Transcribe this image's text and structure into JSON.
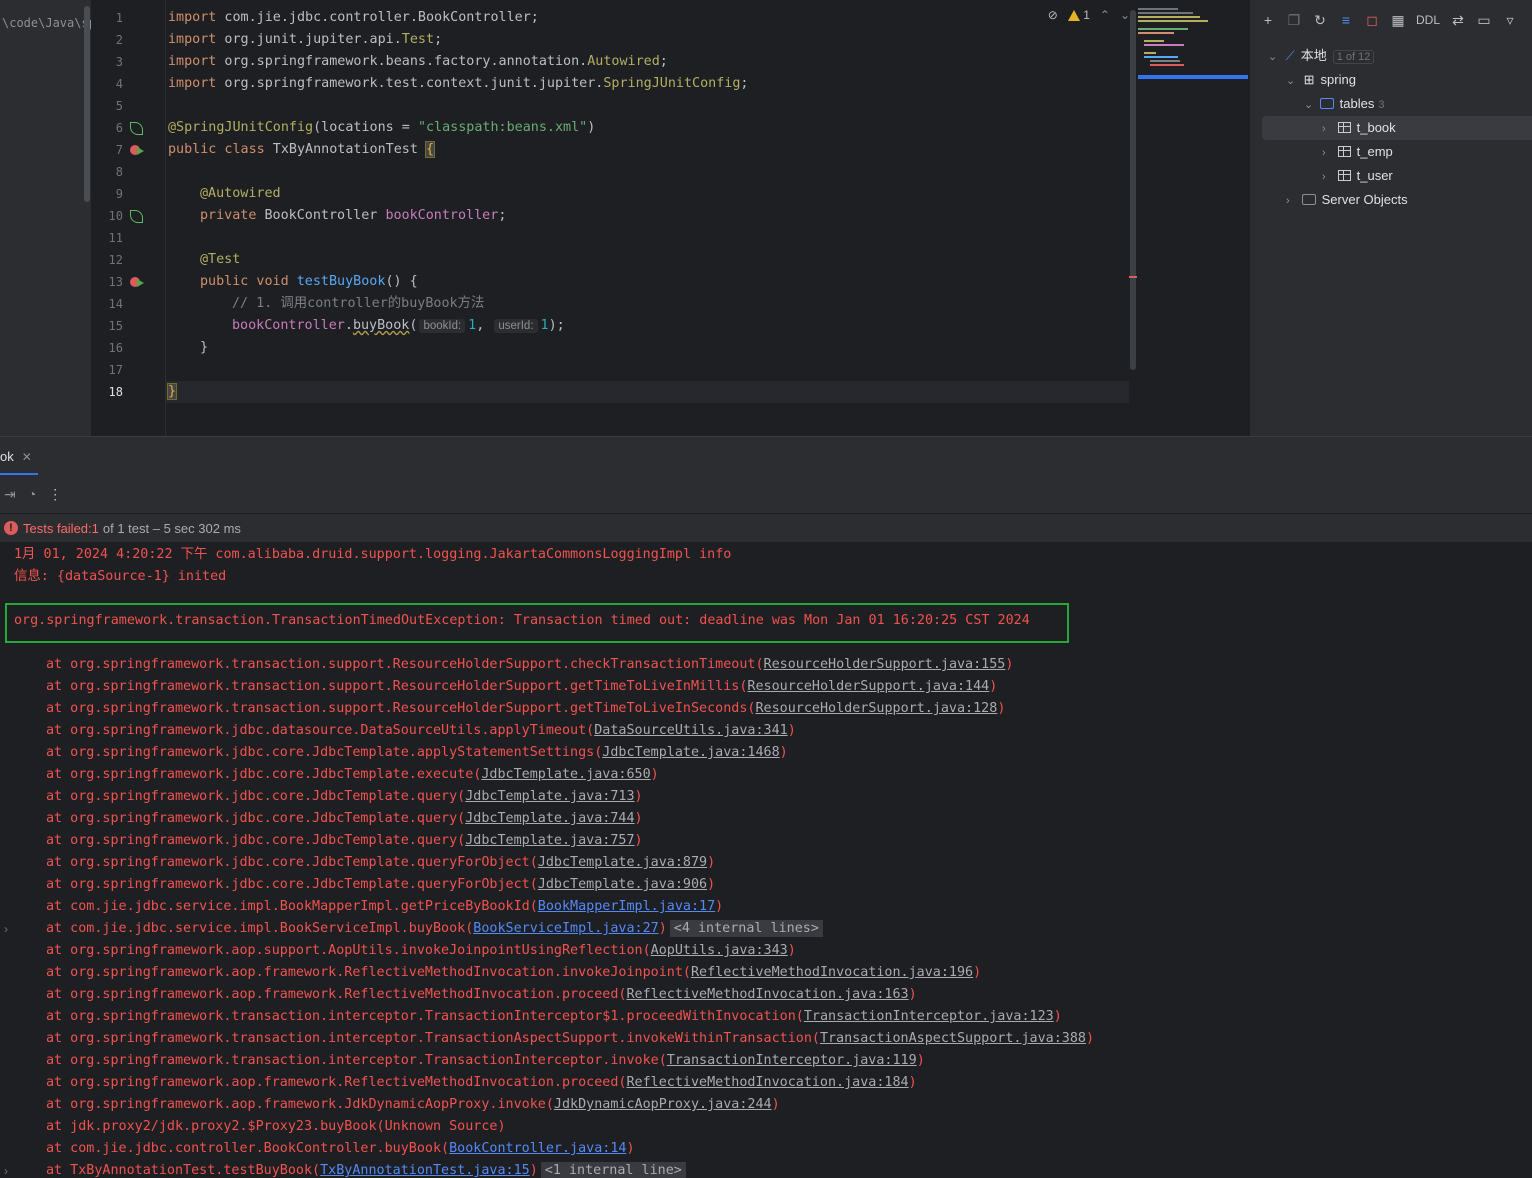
{
  "project": {
    "path": "\\code\\Java\\sp"
  },
  "editor": {
    "line_numbers": [
      "1",
      "2",
      "3",
      "4",
      "5",
      "6",
      "7",
      "8",
      "9",
      "10",
      "11",
      "12",
      "13",
      "14",
      "15",
      "16",
      "17",
      "18"
    ],
    "active_line": "18",
    "toolbar": {
      "warning_count": "1"
    },
    "code": {
      "l1": {
        "kw": "import",
        "pkg": " com.jie.jdbc.controller.BookController;"
      },
      "l2": {
        "kw": "import",
        "pkg": " org.junit.jupiter.api.",
        "cls": "Test",
        "end": ";"
      },
      "l3": {
        "kw": "import",
        "pkg": " org.springframework.beans.factory.annotation.",
        "cls": "Autowired",
        "end": ";"
      },
      "l4": {
        "kw": "import",
        "pkg": " org.springframework.test.context.junit.jupiter.",
        "cls": "SpringJUnitConfig",
        "end": ";"
      },
      "l6": {
        "ann": "@SpringJUnitConfig",
        "p1": "(locations = ",
        "str": "\"classpath:beans.xml\"",
        "p2": ")"
      },
      "l7": {
        "kw": "public class",
        "name": " TxByAnnotationTest ",
        "brace": "{"
      },
      "l9": {
        "ann": "@Autowired"
      },
      "l10": {
        "kw": "private",
        "type": " BookController ",
        "fld": "bookController",
        "end": ";"
      },
      "l12": {
        "ann": "@Test"
      },
      "l13": {
        "kw": "public void",
        "fn": "testBuyBook",
        "rest": "() {"
      },
      "l14": {
        "cmt": "// 1. 调用controller的buyBook方法"
      },
      "l15": {
        "fld": "bookController",
        "dot": ".",
        "fn": "buyBook",
        "open": "(",
        "hint1": "bookId:",
        "v1": "1",
        "comma": ", ",
        "hint2": "userId:",
        "v2": "1",
        "close": ");"
      },
      "l16": {
        "brace": "}"
      },
      "l18": {
        "brace": "}"
      }
    }
  },
  "db_panel": {
    "toolbar": {
      "ddl_label": "DDL"
    },
    "tree": {
      "root": {
        "label": "本地",
        "badge": "1 of 12"
      },
      "schema": {
        "label": "spring"
      },
      "tables": {
        "label": "tables",
        "count": "3"
      },
      "items": [
        "t_book",
        "t_emp",
        "t_user"
      ],
      "server_objects": {
        "label": "Server Objects"
      }
    }
  },
  "run": {
    "tab_label": "ok",
    "status": {
      "failed": "Tests failed: ",
      "failed_count": "1",
      "detail": "of 1 test – 5 sec 302 ms"
    },
    "console": {
      "log1": "1月 01, 2024 4:20:22 下午 com.alibaba.druid.support.logging.JakartaCommonsLoggingImpl info",
      "log2": "信息: {dataSource-1} inited",
      "exception": "org.springframework.transaction.TransactionTimedOutException: Transaction timed out: deadline was Mon Jan 01 16:20:25 CST 2024",
      "trace": [
        {
          "m": "at org.springframework.transaction.support.ResourceHolderSupport.checkTransactionTimeout(",
          "l": "ResourceHolderSupport.java:155",
          "e": ")"
        },
        {
          "m": "at org.springframework.transaction.support.ResourceHolderSupport.getTimeToLiveInMillis(",
          "l": "ResourceHolderSupport.java:144",
          "e": ")"
        },
        {
          "m": "at org.springframework.transaction.support.ResourceHolderSupport.getTimeToLiveInSeconds(",
          "l": "ResourceHolderSupport.java:128",
          "e": ")"
        },
        {
          "m": "at org.springframework.jdbc.datasource.DataSourceUtils.applyTimeout(",
          "l": "DataSourceUtils.java:341",
          "e": ")"
        },
        {
          "m": "at org.springframework.jdbc.core.JdbcTemplate.applyStatementSettings(",
          "l": "JdbcTemplate.java:1468",
          "e": ")"
        },
        {
          "m": "at org.springframework.jdbc.core.JdbcTemplate.execute(",
          "l": "JdbcTemplate.java:650",
          "e": ")"
        },
        {
          "m": "at org.springframework.jdbc.core.JdbcTemplate.query(",
          "l": "JdbcTemplate.java:713",
          "e": ")"
        },
        {
          "m": "at org.springframework.jdbc.core.JdbcTemplate.query(",
          "l": "JdbcTemplate.java:744",
          "e": ")"
        },
        {
          "m": "at org.springframework.jdbc.core.JdbcTemplate.query(",
          "l": "JdbcTemplate.java:757",
          "e": ")"
        },
        {
          "m": "at org.springframework.jdbc.core.JdbcTemplate.queryForObject(",
          "l": "JdbcTemplate.java:879",
          "e": ")"
        },
        {
          "m": "at org.springframework.jdbc.core.JdbcTemplate.queryForObject(",
          "l": "JdbcTemplate.java:906",
          "e": ")"
        },
        {
          "m": "at com.jie.jdbc.service.impl.BookMapperImpl.getPriceByBookId(",
          "l": "BookMapperImpl.java:17",
          "e": ")",
          "blue": true
        },
        {
          "m": "at com.jie.jdbc.service.impl.BookServiceImpl.buyBook(",
          "l": "BookServiceImpl.java:27",
          "e": ")",
          "blue": true,
          "internal": "<4 internal lines>",
          "fold": true
        },
        {
          "m": "at org.springframework.aop.support.AopUtils.invokeJoinpointUsingReflection(",
          "l": "AopUtils.java:343",
          "e": ")"
        },
        {
          "m": "at org.springframework.aop.framework.ReflectiveMethodInvocation.invokeJoinpoint(",
          "l": "ReflectiveMethodInvocation.java:196",
          "e": ")"
        },
        {
          "m": "at org.springframework.aop.framework.ReflectiveMethodInvocation.proceed(",
          "l": "ReflectiveMethodInvocation.java:163",
          "e": ")"
        },
        {
          "m": "at org.springframework.transaction.interceptor.TransactionInterceptor$1.proceedWithInvocation(",
          "l": "TransactionInterceptor.java:123",
          "e": ")"
        },
        {
          "m": "at org.springframework.transaction.interceptor.TransactionAspectSupport.invokeWithinTransaction(",
          "l": "TransactionAspectSupport.java:388",
          "e": ")"
        },
        {
          "m": "at org.springframework.transaction.interceptor.TransactionInterceptor.invoke(",
          "l": "TransactionInterceptor.java:119",
          "e": ")"
        },
        {
          "m": "at org.springframework.aop.framework.ReflectiveMethodInvocation.proceed(",
          "l": "ReflectiveMethodInvocation.java:184",
          "e": ")"
        },
        {
          "m": "at org.springframework.aop.framework.JdkDynamicAopProxy.invoke(",
          "l": "JdkDynamicAopProxy.java:244",
          "e": ")"
        },
        {
          "m": "at jdk.proxy2/jdk.proxy2.$Proxy23.buyBook(Unknown Source)",
          "l": "",
          "e": ""
        },
        {
          "m": "at com.jie.jdbc.controller.BookController.buyBook(",
          "l": "BookController.java:14",
          "e": ")",
          "blue": true
        },
        {
          "m": "at TxByAnnotationTest.testBuyBook(",
          "l": "TxByAnnotationTest.java:15",
          "e": ")",
          "blue": true,
          "internal": "<1 internal line>",
          "fold": true
        }
      ]
    }
  }
}
